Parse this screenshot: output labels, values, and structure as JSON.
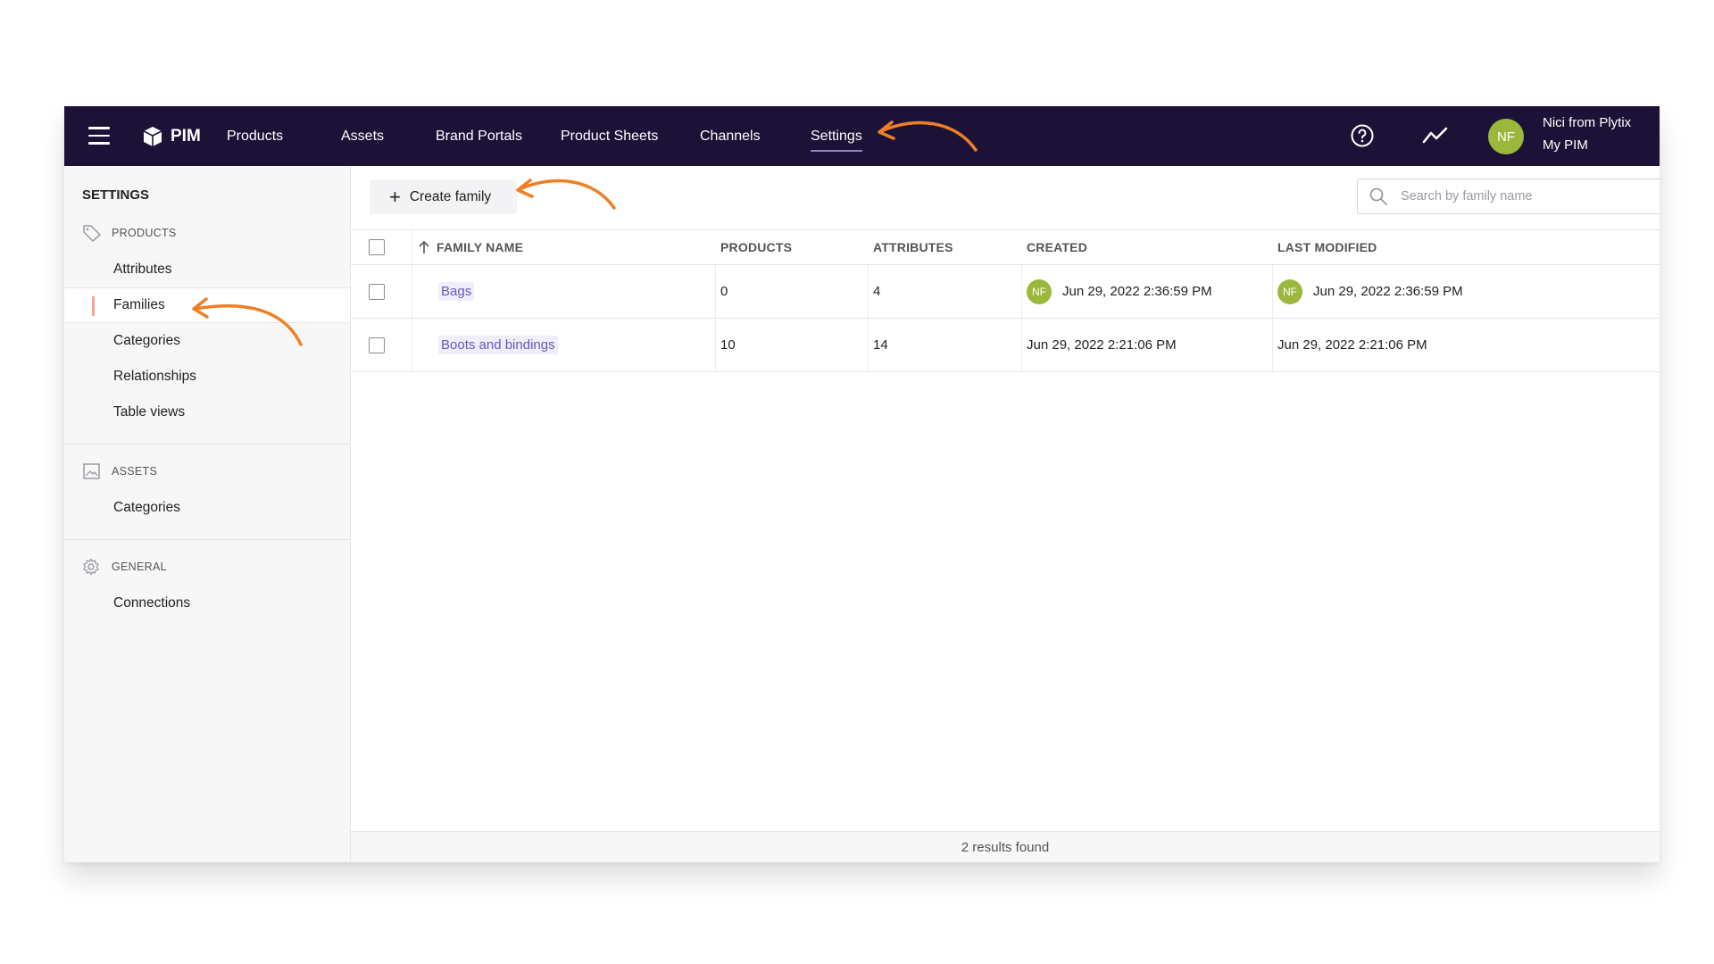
{
  "topbar": {
    "brand": "PIM",
    "nav": [
      "Products",
      "Assets",
      "Brand Portals",
      "Product Sheets",
      "Channels",
      "Settings"
    ],
    "active_nav": "Settings",
    "user": {
      "initials": "NF",
      "name": "Nici from Plytix",
      "account": "My PIM"
    }
  },
  "sidebar": {
    "title": "SETTINGS",
    "sections": [
      {
        "label": "PRODUCTS",
        "icon": "tag-icon",
        "items": [
          "Attributes",
          "Families",
          "Categories",
          "Relationships",
          "Table views"
        ]
      },
      {
        "label": "ASSETS",
        "icon": "image-icon",
        "items": [
          "Categories"
        ]
      },
      {
        "label": "GENERAL",
        "icon": "gear-icon",
        "items": [
          "Connections"
        ]
      }
    ],
    "active_item": "Families"
  },
  "toolbar": {
    "create_label": "Create family",
    "search_placeholder": "Search by family name"
  },
  "table": {
    "columns": [
      "FAMILY NAME",
      "PRODUCTS",
      "ATTRIBUTES",
      "CREATED",
      "LAST MODIFIED"
    ],
    "sort": {
      "column": "FAMILY NAME",
      "direction": "ascending"
    },
    "rows": [
      {
        "name": "Bags",
        "products": "0",
        "attributes": "4",
        "created_by": "NF",
        "created": "Jun 29, 2022 2:36:59 PM",
        "modified_by": "NF",
        "modified": "Jun 29, 2022 2:36:59 PM"
      },
      {
        "name": "Boots and bindings",
        "products": "10",
        "attributes": "14",
        "created": "Jun 29, 2022 2:21:06 PM",
        "modified": "Jun 29, 2022 2:21:06 PM"
      }
    ]
  },
  "footer": {
    "results": "2 results found"
  },
  "colors": {
    "topbar": "#1c1237",
    "avatar": "#9bb83c",
    "link": "#6a55c2",
    "annotation_arrow": "#f07f24"
  }
}
